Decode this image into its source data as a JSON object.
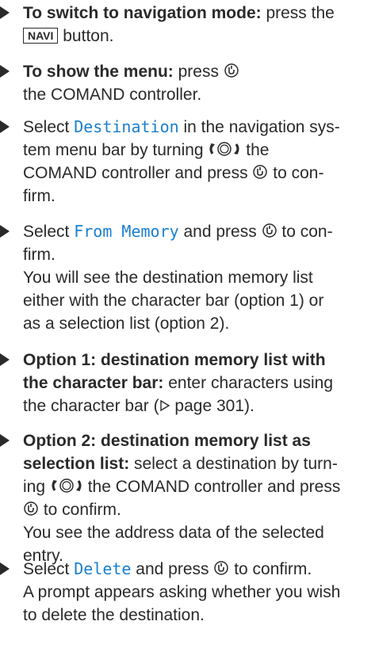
{
  "steps": [
    {
      "bold": "To switch to navigation mode:",
      "a": " press the ",
      "key": "NAVI",
      "b": " button."
    },
    {
      "bold": "To show the menu:",
      "a": " press ",
      "b": " the COMAND controller."
    },
    {
      "a": "Select ",
      "mono": "Destination",
      "b": " in the navigation sys-",
      "c": "tem menu bar by turning ",
      "d": " the",
      "e": "COMAND controller and press ",
      "f": " to con-",
      "g": "firm."
    },
    {
      "a": "Select ",
      "mono": "From Memory",
      "b": " and press ",
      "c": " to con-",
      "d": "firm.",
      "e": "You will see the destination memory list",
      "f": "either with the character bar (option 1) or",
      "g": "as a selection list (option 2)."
    },
    {
      "bold1": "Option 1: destination memory list with",
      "bold2": "the character bar:",
      "a": " enter characters using",
      "b": "the character bar (",
      "c": " page 301)."
    },
    {
      "bold1": "Option 2: destination memory list as",
      "bold2": "selection list:",
      "a": " select a destination by turn-",
      "b": "ing ",
      "c": " the COMAND controller and press",
      "d": " to confirm.",
      "e": "You see the address data of the selected",
      "f": "entry."
    },
    {
      "a": "Select ",
      "mono": "Delete",
      "b": " and press ",
      "c": " to confirm.",
      "d": "A prompt appears asking whether you wish",
      "e": "to delete the destination."
    }
  ],
  "icons": {
    "press": "press-controller-icon",
    "turn": "turn-controller-icon",
    "pageref": "page-reference-triangle-icon"
  },
  "colors": {
    "text": "#2a2a2a",
    "mono": "#1a7fcf"
  }
}
